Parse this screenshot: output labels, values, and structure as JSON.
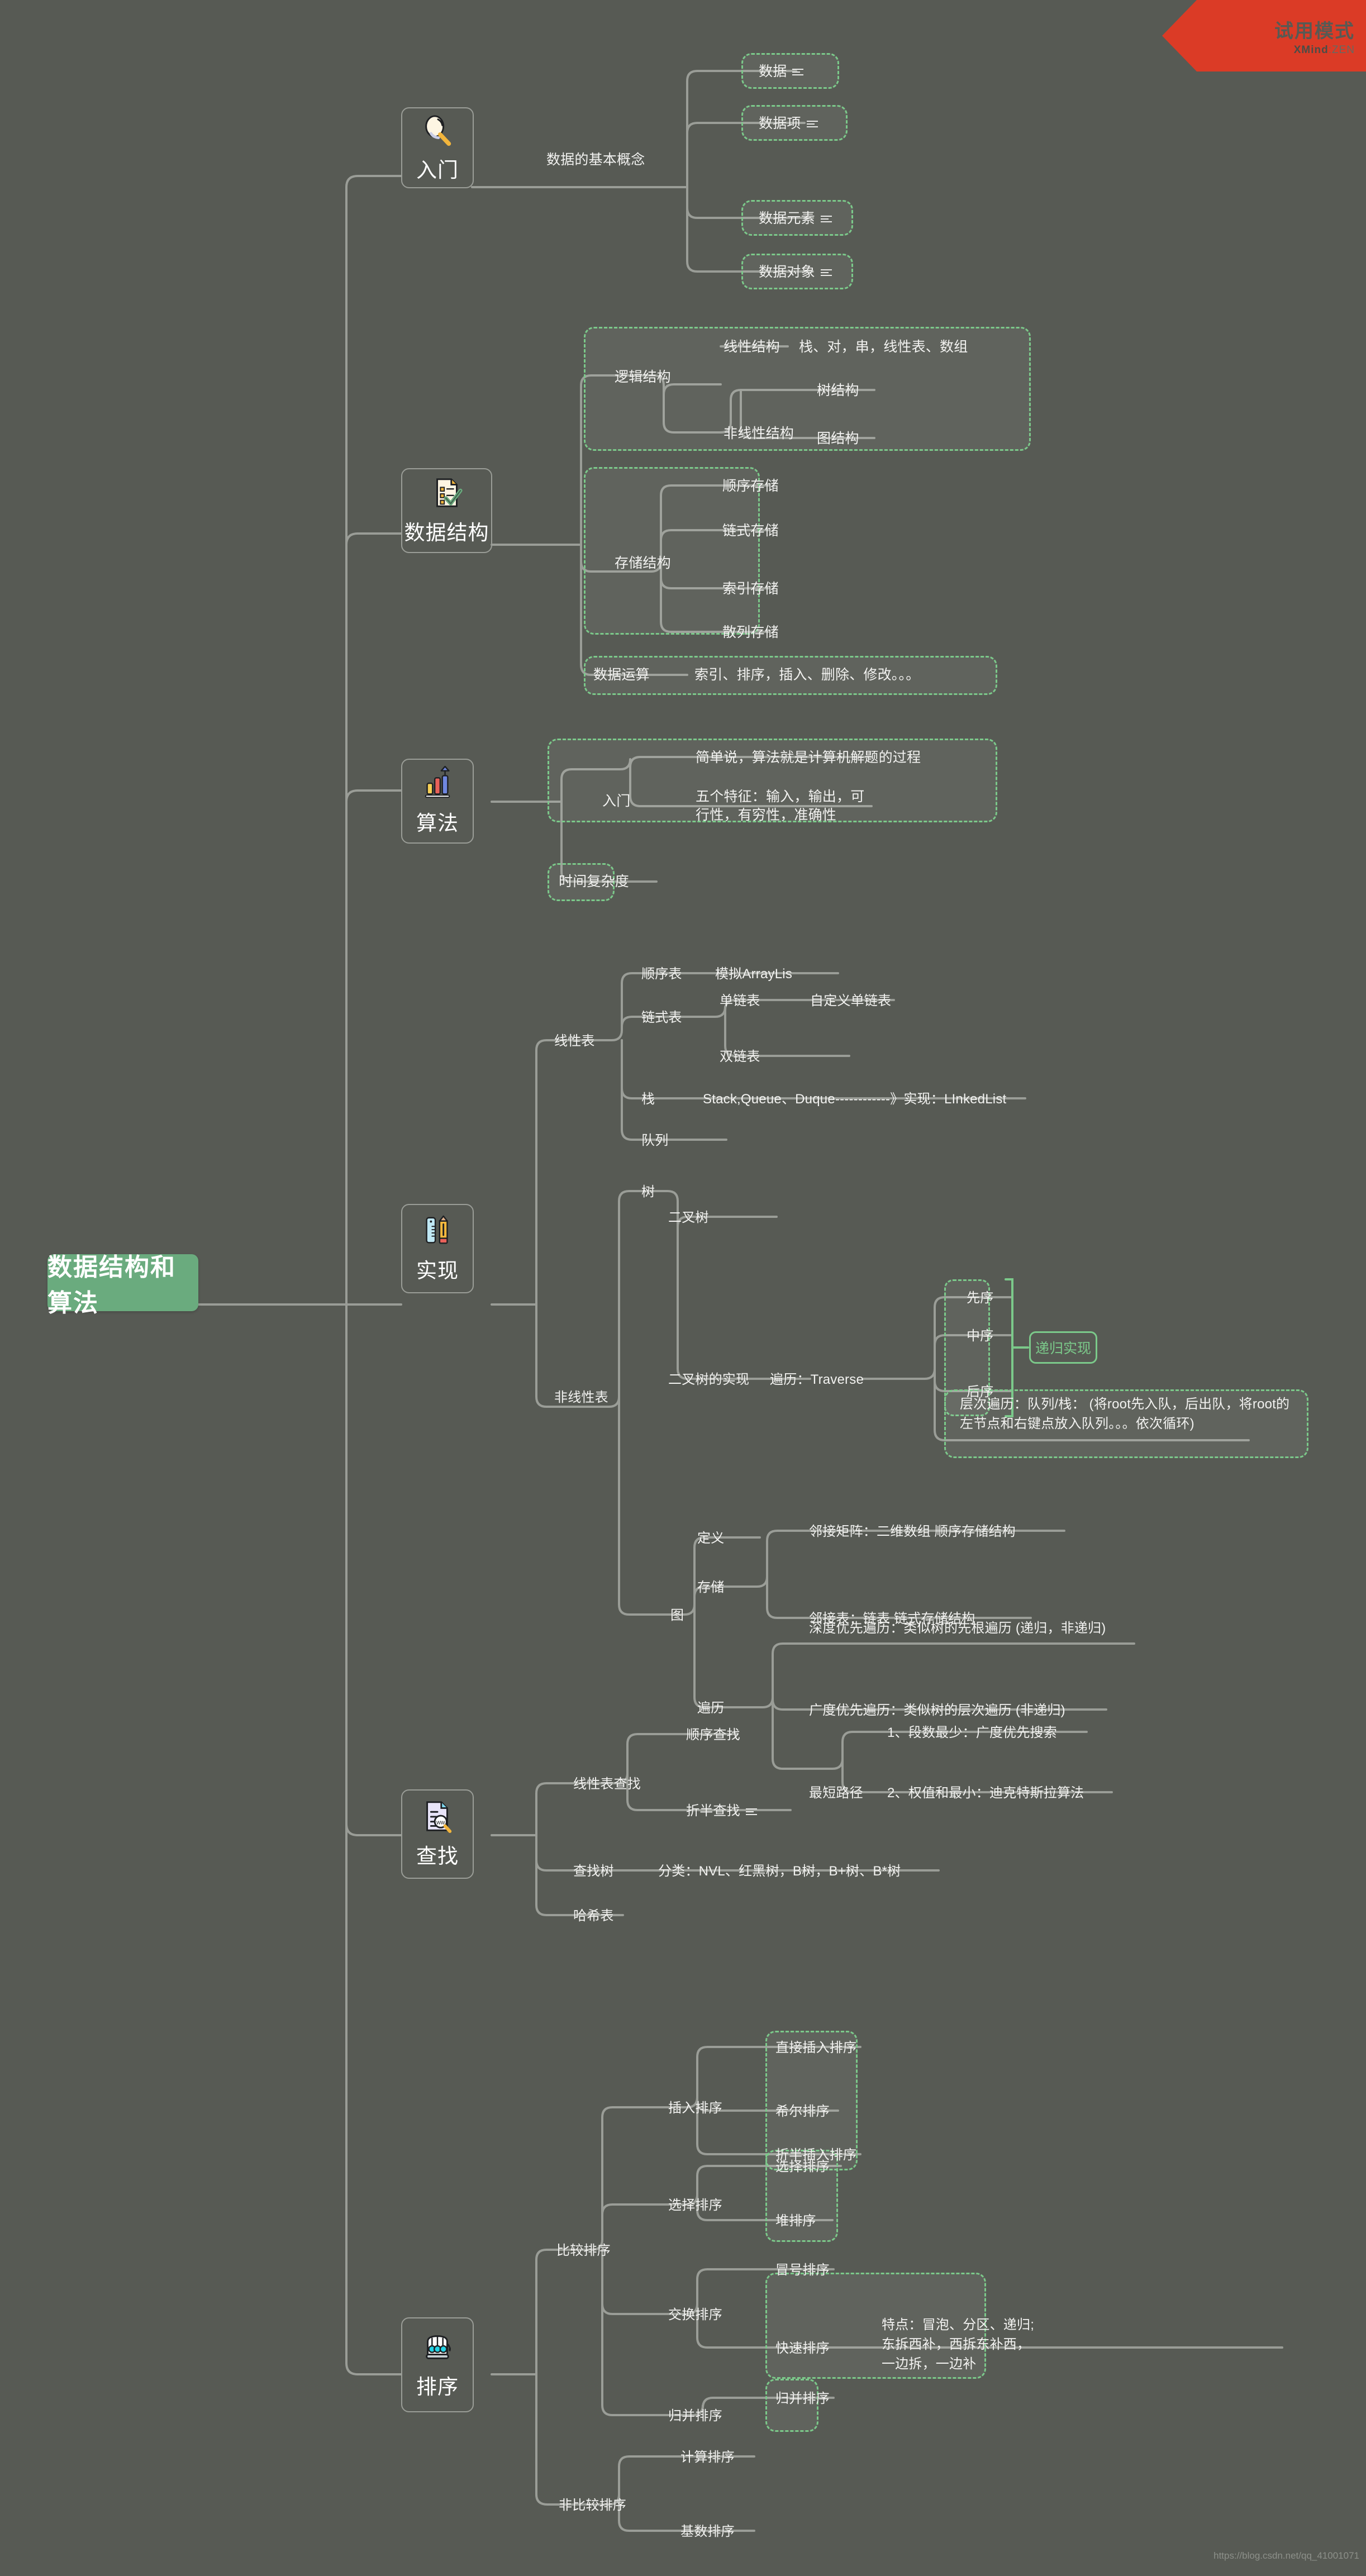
{
  "watermark": {
    "ribbon_title": "试用模式",
    "ribbon_brand_bold": "XMind",
    "ribbon_brand_rest": ":ZEN",
    "url": "https://blog.csdn.net/qq_41001071"
  },
  "root": {
    "label": "数据结构和算法"
  },
  "branches": [
    {
      "id": "intro",
      "label": "入门",
      "icon": "magnifier-icon",
      "children": [
        {
          "label": "数据的基本概念",
          "children": [
            {
              "label": "数据",
              "has_note": true
            },
            {
              "label": "数据项",
              "has_note": true
            },
            {
              "label": "数据元素",
              "has_note": true
            },
            {
              "label": "数据对象",
              "has_note": true
            }
          ]
        }
      ]
    },
    {
      "id": "datastructure",
      "label": "数据结构",
      "icon": "checklist-doc-icon",
      "children": [
        {
          "label": "逻辑结构",
          "children": [
            {
              "label": "线性结构",
              "detail": "栈、对，串，线性表、数组"
            },
            {
              "label": "非线性结构",
              "children": [
                {
                  "label": "树结构"
                },
                {
                  "label": "图结构"
                }
              ]
            }
          ]
        },
        {
          "label": "存储结构",
          "children": [
            {
              "label": "顺序存储"
            },
            {
              "label": "链式存储"
            },
            {
              "label": "索引存储"
            },
            {
              "label": "散列存储"
            }
          ]
        },
        {
          "label": "数据运算",
          "detail": "索引、排序，插入、删除、修改。。。"
        }
      ]
    },
    {
      "id": "algorithm",
      "label": "算法",
      "icon": "bar-chart-arrow-icon",
      "children": [
        {
          "label": "入门",
          "children": [
            {
              "label": "简单说，算法就是计算机解题的过程"
            },
            {
              "label": "五个特征：输入，输出，可行性，有穷性，准确性"
            }
          ]
        },
        {
          "label": "时间复杂度"
        }
      ]
    },
    {
      "id": "implementation",
      "label": "实现",
      "icon": "ruler-pencil-icon",
      "children": [
        {
          "label": "线性表",
          "children": [
            {
              "label": "顺序表",
              "detail": "模拟ArrayLis"
            },
            {
              "label": "链式表",
              "children": [
                {
                  "label": "单链表",
                  "detail": "自定义单链表"
                },
                {
                  "label": "双链表"
                }
              ]
            },
            {
              "label": "栈",
              "detail": "Stack,Queue、Duque------------》实现：LInkedList"
            },
            {
              "label": "队列"
            }
          ]
        },
        {
          "label": "非线性表",
          "children": [
            {
              "label": "树",
              "children": [
                {
                  "label": "二叉树"
                },
                {
                  "label": "二叉树的实现",
                  "detail": "遍历：Traverse",
                  "children": [
                    {
                      "label": "先序"
                    },
                    {
                      "label": "中序"
                    },
                    {
                      "label": "后序"
                    },
                    {
                      "label": "层次遍历：队列/栈： (将root先入队，后出队，将root的左节点和右键点放入队列。。。依次循环)"
                    }
                  ],
                  "callout": "递归实现"
                }
              ]
            },
            {
              "label": "图",
              "children": [
                {
                  "label": "定义"
                },
                {
                  "label": "存储",
                  "children": [
                    {
                      "label": "邻接矩阵：二维数组 顺序存储结构"
                    },
                    {
                      "label": "邻接表：链表 链式存储结构"
                    }
                  ]
                },
                {
                  "label": "遍历",
                  "children": [
                    {
                      "label": "深度优先遍历：类似树的先根遍历 (递归，非递归)"
                    },
                    {
                      "label": "广度优先遍历：类似树的层次遍历 (非递归)"
                    },
                    {
                      "label": "最短路径",
                      "children": [
                        {
                          "label": "1、段数最少：广度优先搜索"
                        },
                        {
                          "label": "2、权值和最小：迪克特斯拉算法"
                        }
                      ]
                    }
                  ]
                }
              ]
            }
          ]
        }
      ]
    },
    {
      "id": "search",
      "label": "查找",
      "icon": "doc-search-icon",
      "children": [
        {
          "label": "线性表查找",
          "children": [
            {
              "label": "顺序查找"
            },
            {
              "label": "折半查找",
              "has_note": true
            }
          ]
        },
        {
          "label": "查找树",
          "detail": "分类：NVL、红黑树，B树，B+树、B*树"
        },
        {
          "label": "哈希表"
        }
      ]
    },
    {
      "id": "sort",
      "label": "排序",
      "icon": "newton-cradle-icon",
      "children": [
        {
          "label": "比较排序",
          "children": [
            {
              "label": "插入排序",
              "children": [
                {
                  "label": "直接插入排序"
                },
                {
                  "label": "希尔排序"
                },
                {
                  "label": "折半插入排序"
                }
              ]
            },
            {
              "label": "选择排序",
              "children": [
                {
                  "label": "选择排序"
                },
                {
                  "label": "堆排序"
                }
              ]
            },
            {
              "label": "交换排序",
              "children": [
                {
                  "label": "冒号排序"
                },
                {
                  "label": "快速排序",
                  "detail": "特点：冒泡、分区、递归; 东拆西补，西拆东补西，一边拆，一边补"
                }
              ]
            },
            {
              "label": "归并排序",
              "children": [
                {
                  "label": "归并排序"
                }
              ]
            }
          ]
        },
        {
          "label": "非比较排序",
          "children": [
            {
              "label": "计算排序"
            },
            {
              "label": "基数排序"
            }
          ]
        }
      ]
    }
  ]
}
